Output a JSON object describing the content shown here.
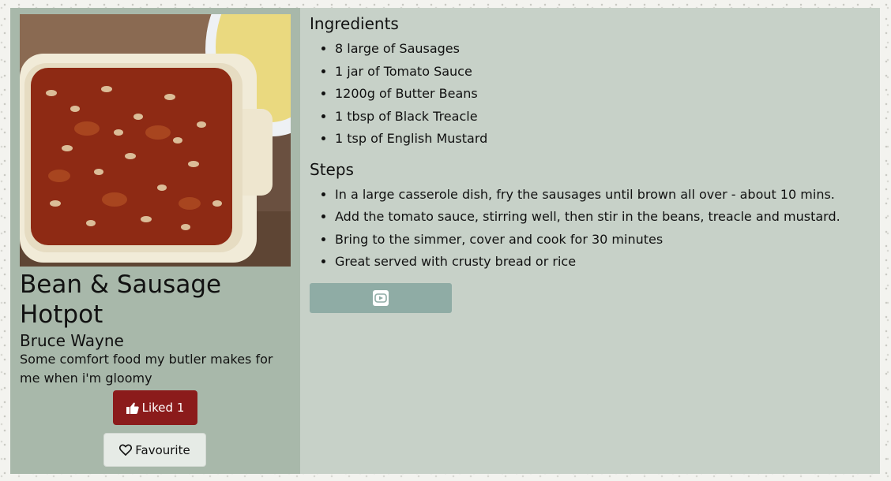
{
  "recipe": {
    "title": "Bean & Sausage Hotpot",
    "author": "Bruce Wayne",
    "description": "Some comfort food my butler makes for me when i'm gloomy",
    "like_label": "Liked 1",
    "favourite_label": "Favourite"
  },
  "ingredients": {
    "heading": "Ingredients",
    "items": [
      "8 large of Sausages",
      "1 jar of Tomato Sauce",
      "1200g of Butter Beans",
      "1 tbsp of Black Treacle",
      "1 tsp of English Mustard"
    ]
  },
  "steps": {
    "heading": "Steps",
    "items": [
      "In a large casserole dish, fry the sausages until brown all over - about 10 mins.",
      "Add the tomato sauce, stirring well, then stir in the beans, treacle and mustard.",
      "Bring to the simmer, cover and cook for 30 minutes",
      "Great served with crusty bread or rice"
    ]
  },
  "icons": {
    "like": "thumbs-up-icon",
    "favourite": "heart-outline-icon",
    "video": "youtube-icon"
  },
  "colors": {
    "like_button": "#8b1b1b",
    "left_panel": "#a8b8aa",
    "right_panel": "#c7d1c8",
    "video_button": "#8faca5"
  }
}
